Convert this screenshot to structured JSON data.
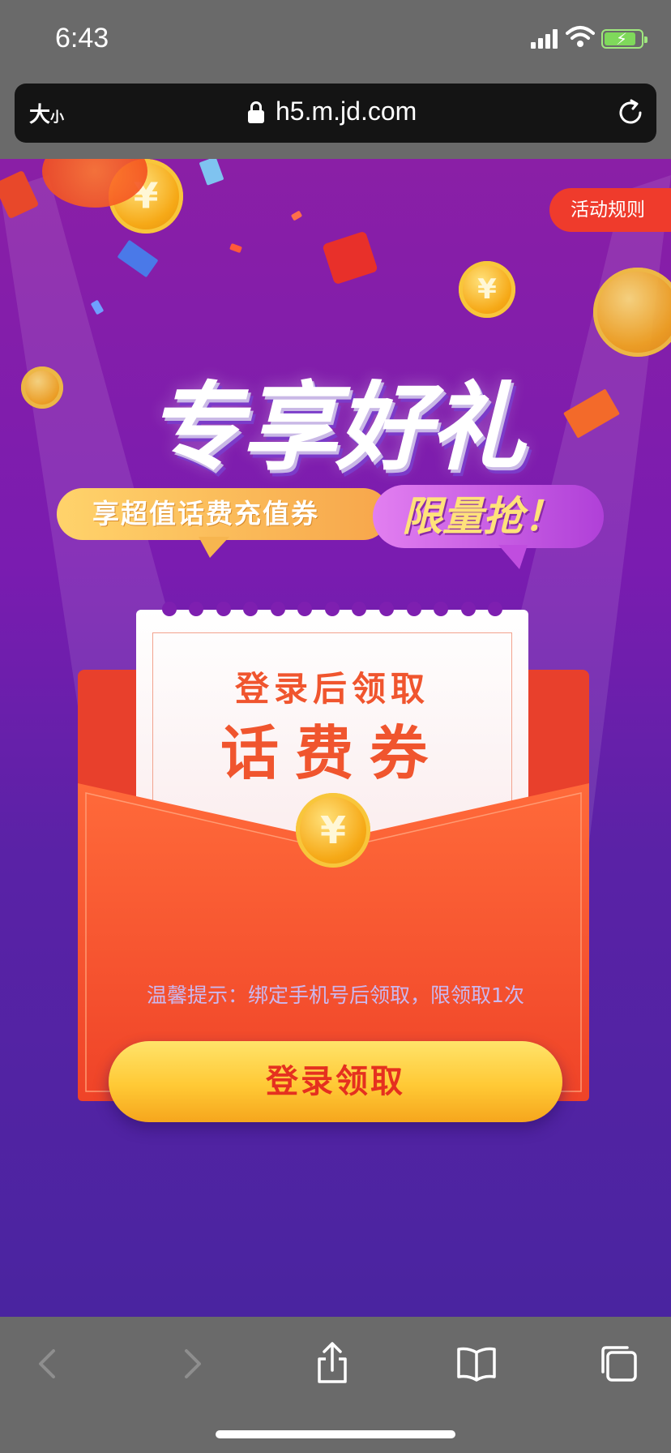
{
  "status_bar": {
    "time": "6:43"
  },
  "address_bar": {
    "text_size_big": "大",
    "text_size_small": "小",
    "url": "h5.m.jd.com"
  },
  "page": {
    "rules_button": "活动规则",
    "headline": "专享好礼",
    "bubble_left": "享超值话费充值券",
    "bubble_right": "限量抢！",
    "card": {
      "line1": "登录后领取",
      "line2": "话费券"
    },
    "coin_symbol": "¥",
    "tip": "温馨提示：绑定手机号后领取，限领取1次",
    "login_button": "登录领取"
  },
  "toolbar": {
    "back_icon": "chevron-left-icon",
    "forward_icon": "chevron-right-icon",
    "share_icon": "share-icon",
    "bookmarks_icon": "book-icon",
    "tabs_icon": "tabs-icon"
  },
  "colors": {
    "accent_red": "#ef3b2c",
    "button_yellow": "#ffc935",
    "purple_bg": "#7a1cb0"
  }
}
